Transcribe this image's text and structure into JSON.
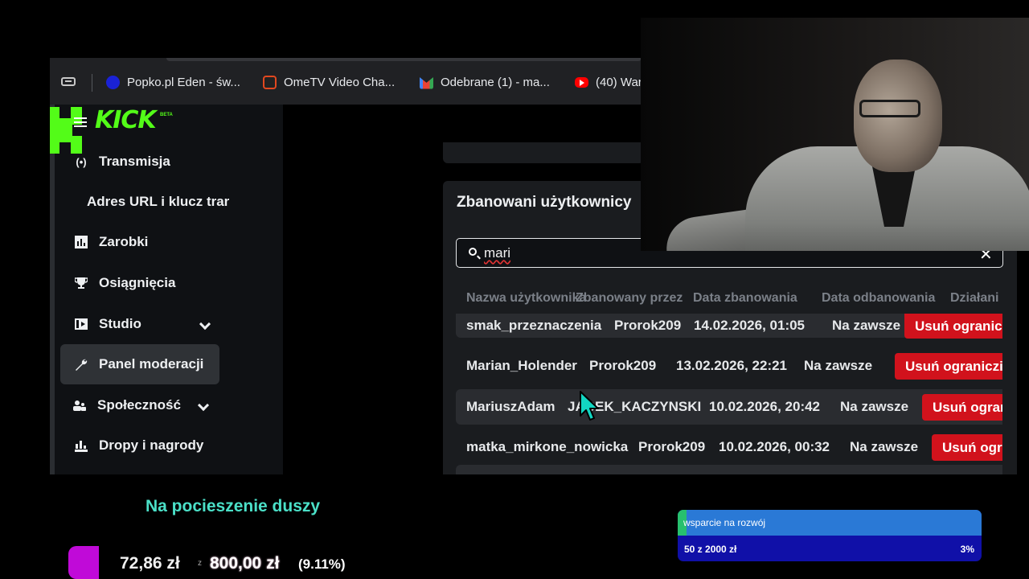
{
  "browser": {
    "tabs": [
      {
        "label": "Popko.pl Eden - św...",
        "icon": "popko-favicon"
      },
      {
        "label": "OmeTV Video Cha...",
        "icon": "ometv-favicon"
      },
      {
        "label": "Odebrane (1) - ma...",
        "icon": "gmail-favicon"
      },
      {
        "label": "(40) War",
        "icon": "youtube-favicon"
      }
    ]
  },
  "logo": {
    "text": "KICK",
    "badge": "BETA"
  },
  "sidebar": {
    "items": [
      {
        "label": "Transmisja",
        "icon": "broadcast-icon"
      },
      {
        "label": "Adres URL i klucz trar",
        "icon": ""
      },
      {
        "label": "Zarobki",
        "icon": "chart-icon"
      },
      {
        "label": "Osiągnięcia",
        "icon": "trophy-icon"
      },
      {
        "label": "Studio",
        "icon": "studio-icon"
      },
      {
        "label": "Panel moderacji",
        "icon": "wrench-icon"
      },
      {
        "label": "Społeczność",
        "icon": "community-icon"
      },
      {
        "label": "Dropy i nagrody",
        "icon": "drops-icon"
      }
    ]
  },
  "banned": {
    "title": "Zbanowani użytkownicy",
    "search_value": "mari",
    "columns": [
      "Nazwa użytkownika",
      "Zbanowany przez",
      "Data zbanowania",
      "Data odbanowania",
      "Działani"
    ],
    "rows": [
      {
        "user": "smak_przeznaczenia",
        "by": "Prorok209",
        "date": "14.02.2026, 01:05",
        "until": "Na zawsze",
        "action": "Usuń ogranic"
      },
      {
        "user": "Marian_Holender",
        "by": "Prorok209",
        "date": "13.02.2026, 22:21",
        "until": "Na zawsze",
        "action": "Usuń ograniczi"
      },
      {
        "user": "MariuszAdam",
        "by": "JACEK_KACZYNSKI",
        "date": "10.02.2026, 20:42",
        "until": "Na zawsze",
        "action": "Usuń ogran"
      },
      {
        "user": "matka_mirkone_nowicka",
        "by": "Prorok209",
        "date": "10.02.2026, 00:32",
        "until": "Na zawsze",
        "action": "Usuń ogr"
      }
    ]
  },
  "overlay": {
    "motto": "Na pocieszenie duszy",
    "goal_current": "72,86 zł",
    "goal_sep": "z",
    "goal_target": "800,00 zł",
    "goal_percent": "(9.11%)",
    "support_title": "wsparcie na rozwój",
    "support_amount": "50  z  2000  zł",
    "support_percent": "3%",
    "support_progress": 0.03
  },
  "colors": {
    "kick_green": "#53fc18",
    "unban_red": "#d1121c",
    "motto_teal": "#4be0c8"
  }
}
